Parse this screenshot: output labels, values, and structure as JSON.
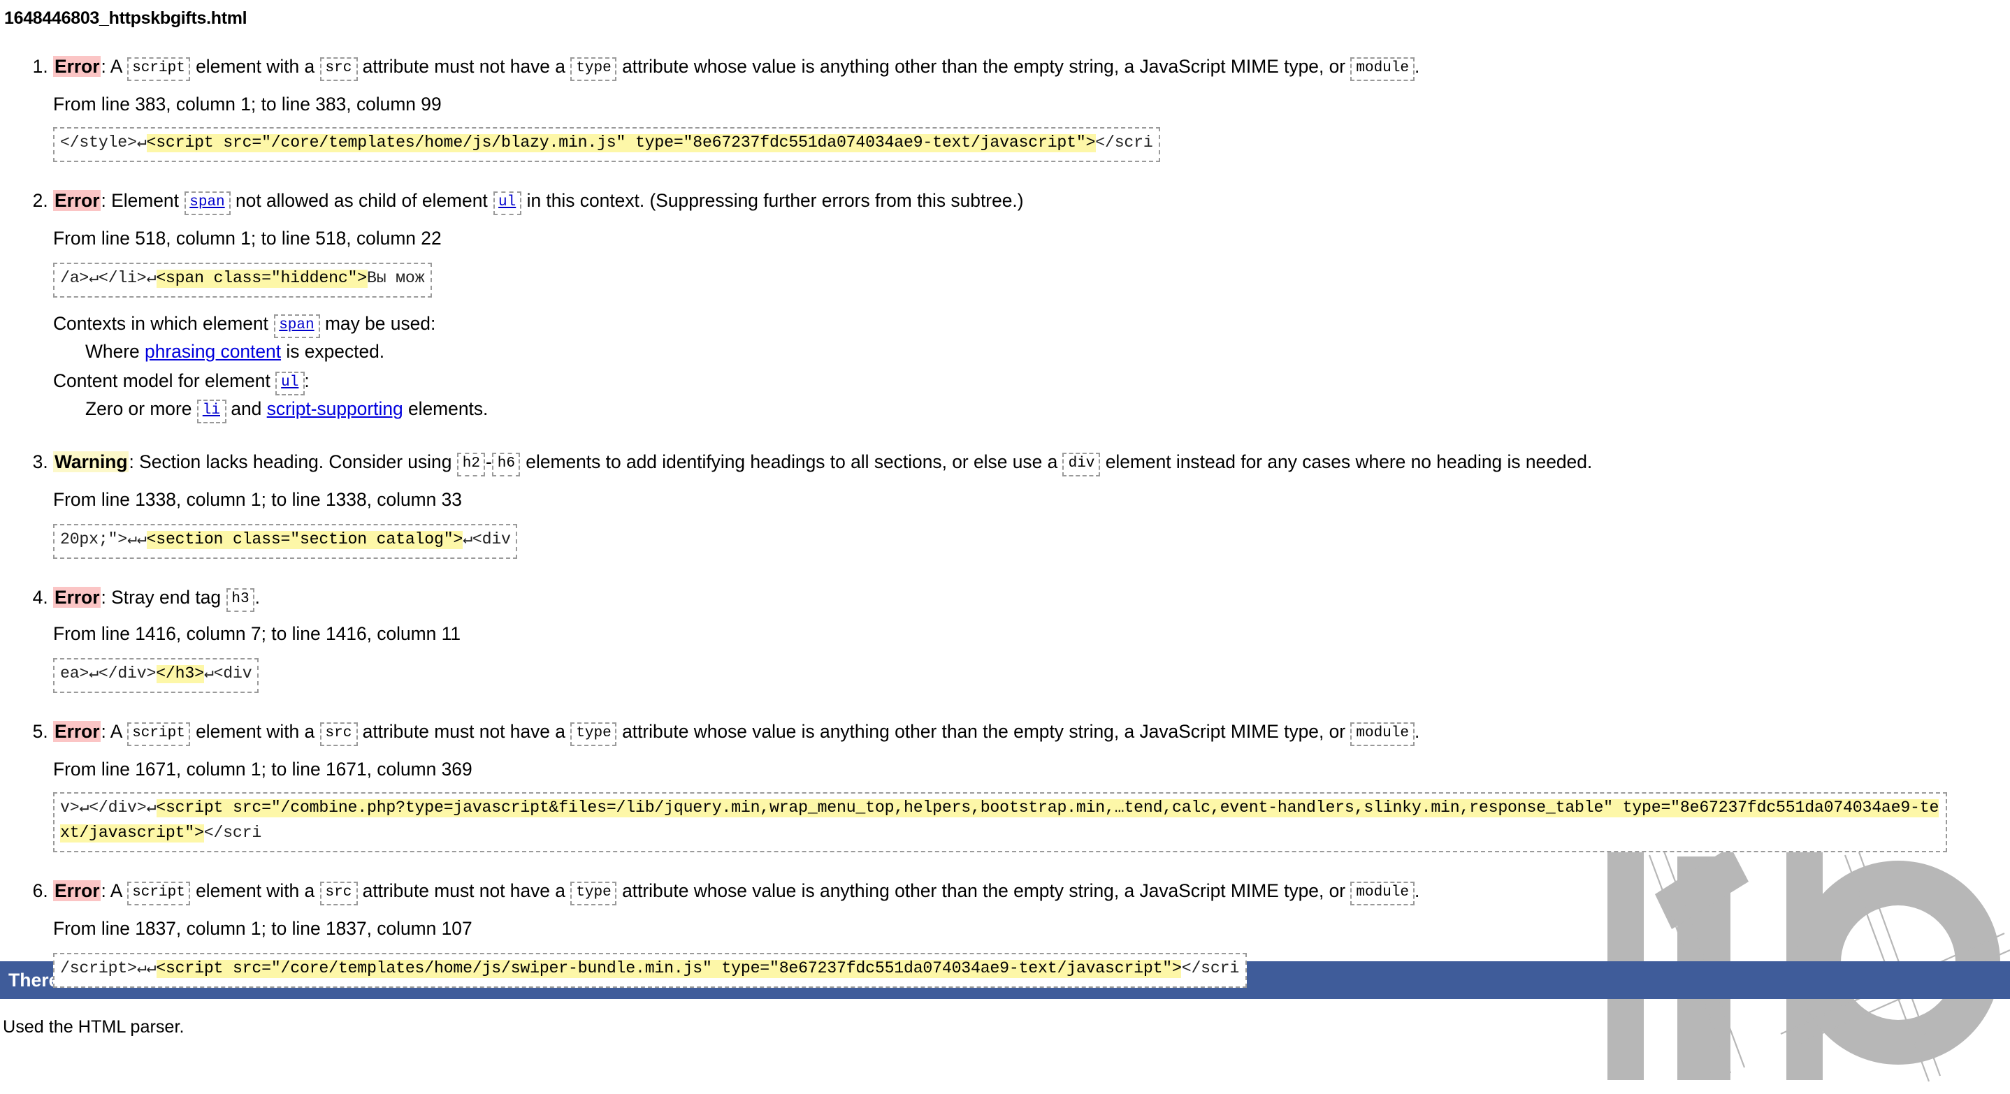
{
  "document": {
    "title": "1648446803_httpskbgifts.html"
  },
  "labels": {
    "error": "Error",
    "warning": "Warning"
  },
  "messages": [
    {
      "index": "1",
      "type": "error",
      "text_parts": [
        ": A ",
        " element with a ",
        " attribute must not have a ",
        " attribute whose value is anything other than the empty string, a JavaScript MIME type, or ",
        "."
      ],
      "codes": [
        "script",
        "src",
        "type",
        "module"
      ],
      "location": "From line 383, column 1; to line 383, column 99",
      "extract": {
        "before": "</style>↵",
        "highlight": "<script src=\"/core/templates/home/js/blazy.min.js\" type=\"8e67237fdc551da074034ae9-text/javascript\">",
        "after": "</scri"
      }
    },
    {
      "index": "2",
      "type": "error",
      "text_parts": [
        ": Element ",
        " not allowed as child of element ",
        " in this context. (Suppressing further errors from this subtree.)"
      ],
      "codes": [
        "span",
        "ul"
      ],
      "location": "From line 518, column 1; to line 518, column 22",
      "extract": {
        "before": "/a>↵</li>↵",
        "highlight": "<span class=\"hiddenc\">",
        "after": "Вы мож"
      },
      "detail": {
        "contexts_label_a": "Contexts in which element ",
        "contexts_code": "span",
        "contexts_label_b": " may be used:",
        "contexts_item_a": "Where ",
        "contexts_item_link": "phrasing content",
        "contexts_item_b": " is expected.",
        "content_label_a": "Content model for element ",
        "content_code": "ul",
        "content_label_b": ":",
        "content_item_a": "Zero or more ",
        "content_item_code": "li",
        "content_item_b": " and ",
        "content_item_link": "script-supporting",
        "content_item_c": " elements."
      }
    },
    {
      "index": "3",
      "type": "warning",
      "text_parts": [
        ": Section lacks heading. Consider using ",
        " elements to add identifying headings to all sections, or else use a ",
        " element instead for any cases where no heading is needed."
      ],
      "codes": [
        "h2",
        "h6",
        "div"
      ],
      "code_separator": "-",
      "location": "From line 1338, column 1; to line 1338, column 33",
      "extract": {
        "before": "20px;\">↵↵",
        "highlight": "<section class=\"section catalog\">",
        "after": "↵<div"
      }
    },
    {
      "index": "4",
      "type": "error",
      "text_parts": [
        ": Stray end tag ",
        "."
      ],
      "codes": [
        "h3"
      ],
      "location": "From line 1416, column 7; to line 1416, column 11",
      "extract": {
        "before": "ea>↵</div>",
        "highlight": "</h3>",
        "after": "↵<div"
      }
    },
    {
      "index": "5",
      "type": "error",
      "text_parts": [
        ": A ",
        " element with a ",
        " attribute must not have a ",
        " attribute whose value is anything other than the empty string, a JavaScript MIME type, or ",
        "."
      ],
      "codes": [
        "script",
        "src",
        "type",
        "module"
      ],
      "location": "From line 1671, column 1; to line 1671, column 369",
      "extract": {
        "before": "v>↵</div>↵",
        "highlight": "<script src=\"/combine.php?type=javascript&files=/lib/jquery.min,wrap_menu_top,helpers,bootstrap.min,…tend,calc,event-handlers,slinky.min,response_table\" type=\"8e67237fdc551da074034ae9-text/javascript\">",
        "after": "</scri"
      }
    },
    {
      "index": "6",
      "type": "error",
      "text_parts": [
        ": A ",
        " element with a ",
        " attribute must not have a ",
        " attribute whose value is anything other than the empty string, a JavaScript MIME type, or ",
        "."
      ],
      "codes": [
        "script",
        "src",
        "type",
        "module"
      ],
      "location": "From line 1837, column 1; to line 1837, column 107",
      "extract": {
        "before": "/script>↵↵",
        "highlight": "<script src=\"/core/templates/home/js/swiper-bundle.min.js\" type=\"8e67237fdc551da074034ae9-text/javascript\">",
        "after": "</scri"
      }
    }
  ],
  "footer": {
    "summary": "There were errors.",
    "note": "Used the HTML parser."
  },
  "colors": {
    "footer_bar": "#3f5c9a",
    "error_highlight": "#fbc5c5",
    "warning_highlight": "#fcf8c9",
    "extract_highlight": "#fdf7a8",
    "link": "#0000cc",
    "watermark": "#b5b5b5"
  },
  "watermark": {
    "text": "kb"
  }
}
